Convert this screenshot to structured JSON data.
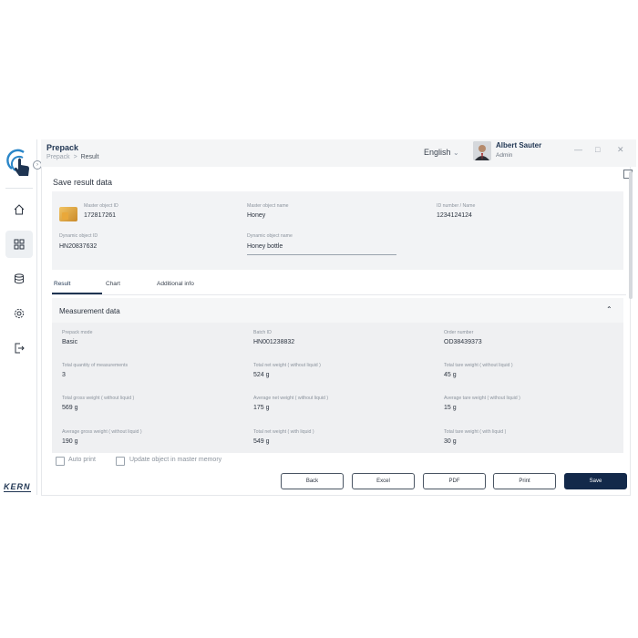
{
  "app": {
    "title": "Prepack",
    "breadcrumb": {
      "parent": "Prepack",
      "separator": ">",
      "current": "Result"
    },
    "language": "English",
    "user": {
      "name": "Albert Sauter",
      "role": "Admin"
    },
    "brand": "KERN"
  },
  "icons": {
    "nav": [
      "home-icon",
      "dashboard-icon",
      "database-icon",
      "settings-icon",
      "logout-icon"
    ],
    "window": [
      "minimize-icon",
      "maximize-icon",
      "close-icon"
    ]
  },
  "colors": {
    "primary": "#13294a",
    "panel": "#f2f3f5",
    "accent_text": "#1f3552"
  },
  "page": {
    "title": "Save result data",
    "info": {
      "master_object_id_label": "Master object ID",
      "master_object_id": "172817261",
      "master_object_name_label": "Master object name",
      "master_object_name": "Honey",
      "id_number_label": "ID number / Name",
      "id_number": "1234124124",
      "dynamic_object_id_label": "Dynamic object ID",
      "dynamic_object_id": "HN20837632",
      "dynamic_object_name_label": "Dynamic object name",
      "dynamic_object_name": "Honey bottle"
    },
    "tabs": [
      {
        "label": "Result",
        "active": true
      },
      {
        "label": "Chart",
        "active": false
      },
      {
        "label": "Additional info",
        "active": false
      }
    ],
    "measurement": {
      "title": "Measurement data",
      "fields": [
        {
          "label": "Prepack mode",
          "value": "Basic"
        },
        {
          "label": "Batch ID",
          "value": "HN001238832"
        },
        {
          "label": "Order number",
          "value": "OD38439373"
        },
        {
          "label": "Total quantity of measurements",
          "value": "3"
        },
        {
          "label": "Total net weight ( without liquid )",
          "value": "524 g"
        },
        {
          "label": "Total tare weight ( without liquid )",
          "value": "45 g"
        },
        {
          "label": "Total gross weight ( without liquid )",
          "value": "569 g"
        },
        {
          "label": "Average net weight ( without liquid )",
          "value": "175 g"
        },
        {
          "label": "Average tare weight ( without liquid )",
          "value": "15 g"
        },
        {
          "label": "Average gross weight ( without liquid )",
          "value": "190 g"
        },
        {
          "label": "Total net weight ( with liquid )",
          "value": "549 g"
        },
        {
          "label": "Total tare weight ( with liquid )",
          "value": "30 g"
        }
      ]
    },
    "options": {
      "auto_print": "Auto print",
      "update_master": "Update object in master memory"
    },
    "buttons": {
      "back": "Back",
      "excel": "Excel",
      "pdf": "PDF",
      "print": "Print",
      "save": "Save"
    }
  }
}
